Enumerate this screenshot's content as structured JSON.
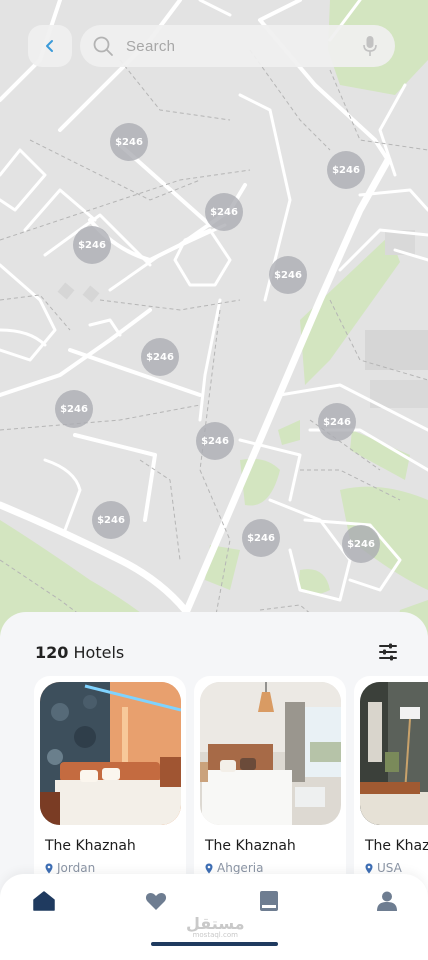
{
  "header": {
    "search_placeholder": "Search"
  },
  "map": {
    "pins": [
      {
        "price": "$246"
      },
      {
        "price": "$246"
      },
      {
        "price": "$246"
      },
      {
        "price": "$246"
      },
      {
        "price": "$246"
      },
      {
        "price": "$246"
      },
      {
        "price": "$246"
      },
      {
        "price": "$246"
      },
      {
        "price": "$246"
      },
      {
        "price": "$246"
      },
      {
        "price": "$246"
      }
    ]
  },
  "results": {
    "count": "120",
    "count_label": "Hotels",
    "hotels": [
      {
        "name": "The Khaznah",
        "location": "Jordan"
      },
      {
        "name": "The Khaznah",
        "location": "Ahgeria"
      },
      {
        "name": "The Khaznah",
        "location": "USA"
      }
    ]
  },
  "tabs": [
    {
      "name": "home",
      "icon": "home-icon"
    },
    {
      "name": "favorites",
      "icon": "heart-icon"
    },
    {
      "name": "bookings",
      "icon": "book-icon"
    },
    {
      "name": "profile",
      "icon": "user-icon"
    }
  ],
  "watermark": {
    "text": "مستقل",
    "sub": "mostaql.com"
  },
  "colors": {
    "accent": "#1f3a5f",
    "back_arrow": "#3a9ad9",
    "map_green": "#d3e5c0"
  }
}
